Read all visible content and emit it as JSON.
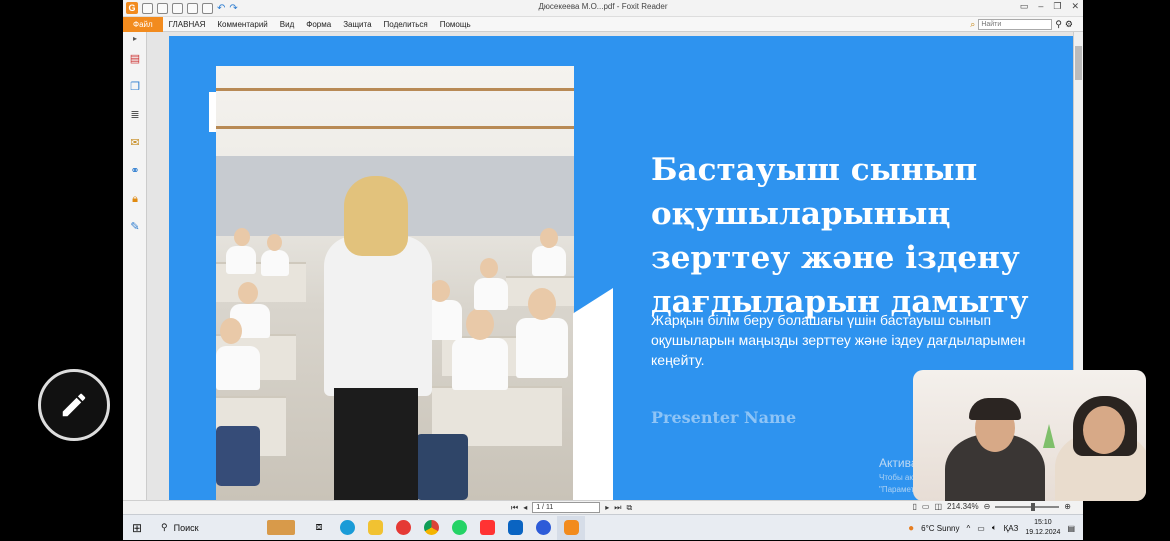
{
  "window": {
    "title": "Дюсекеева М.О...pdf - Foxit Reader"
  },
  "menu": {
    "file": "Файл",
    "items": [
      "ГЛАВНАЯ",
      "Комментарий",
      "Вид",
      "Форма",
      "Защита",
      "Поделиться",
      "Помощь"
    ],
    "search_placeholder": "Найти"
  },
  "slide": {
    "title": "Бастауыш сынып\nоқушыларының\nзерттеу және іздену\nдағдыларын дамыту",
    "subtitle": "Жарқын білім беру болашағы үшін бастауыш сынып оқушыларын маңызды зерттеу және іздеу дағдыларымен кеңейту.",
    "presenter": "Presenter Name",
    "accent_color": "#2e93ef"
  },
  "watermark": {
    "title": "Активация W",
    "line": "Чтобы активирова\n\"Параметры\"."
  },
  "statusbar": {
    "page": "1 / 11",
    "zoom": "214.34%"
  },
  "taskbar": {
    "search": "Поиск",
    "weather": "6°C  Sunny",
    "lang": "ҚАЗ",
    "time": "15:10",
    "date": "19.12.2024"
  },
  "icons": [
    "pencil-icon",
    "search-icon",
    "windows-icon"
  ]
}
